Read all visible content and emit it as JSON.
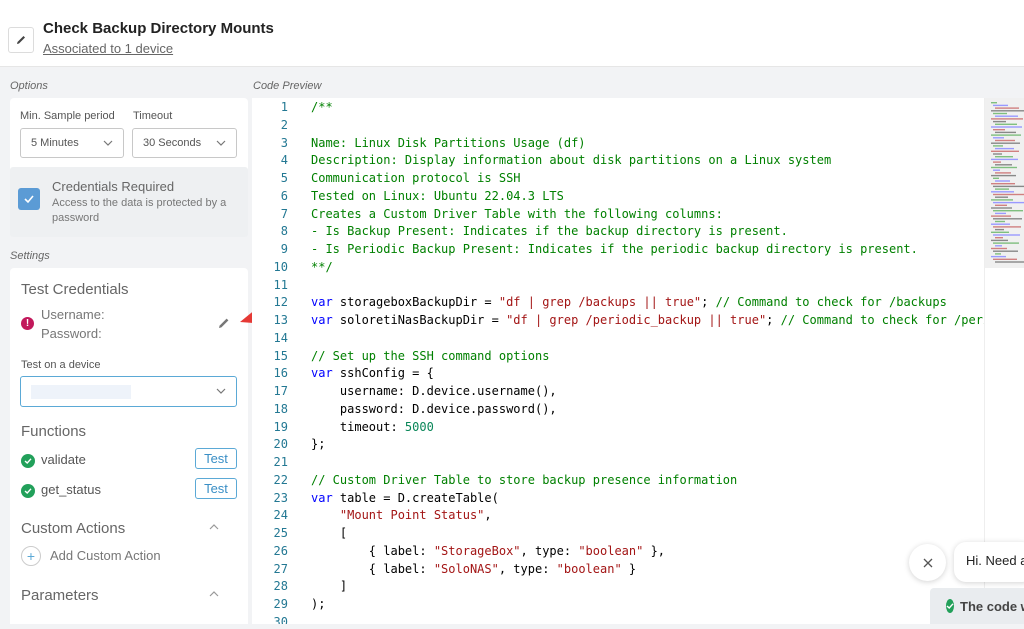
{
  "header": {
    "title": "Check Backup Directory Mounts",
    "associated": "Associated to 1 device"
  },
  "options": {
    "section_label": "Options",
    "min_sample_label": "Min. Sample period",
    "min_sample_value": "5 Minutes",
    "timeout_label": "Timeout",
    "timeout_value": "30 Seconds",
    "cred_title": "Credentials Required",
    "cred_desc": "Access to the data is protected by a password"
  },
  "settings": {
    "section_label": "Settings",
    "test_credentials": "Test Credentials",
    "username_label": "Username:",
    "password_label": "Password:",
    "test_device_label": "Test on a device",
    "functions_heading": "Functions",
    "functions": [
      {
        "name": "validate",
        "button": "Test"
      },
      {
        "name": "get_status",
        "button": "Test"
      }
    ],
    "custom_actions_heading": "Custom Actions",
    "add_custom_action": "Add Custom Action",
    "parameters_heading": "Parameters"
  },
  "code_preview": {
    "section_label": "Code Preview",
    "lines": [
      {
        "n": "1",
        "t": [
          {
            "c": "cm",
            "s": "/**"
          }
        ]
      },
      {
        "n": "2",
        "t": []
      },
      {
        "n": "3",
        "t": [
          {
            "c": "cm",
            "s": "Name: Linux Disk Partitions Usage (df)"
          }
        ]
      },
      {
        "n": "4",
        "t": [
          {
            "c": "cm",
            "s": "Description: Display information about disk partitions on a Linux system"
          }
        ]
      },
      {
        "n": "5",
        "t": [
          {
            "c": "cm",
            "s": "Communication protocol is SSH"
          }
        ]
      },
      {
        "n": "6",
        "t": [
          {
            "c": "cm",
            "s": "Tested on Linux: Ubuntu 22.04.3 LTS"
          }
        ]
      },
      {
        "n": "7",
        "t": [
          {
            "c": "cm",
            "s": "Creates a Custom Driver Table with the following columns:"
          }
        ]
      },
      {
        "n": "8",
        "t": [
          {
            "c": "cm",
            "s": "- Is Backup Present: Indicates if the backup directory is present."
          }
        ]
      },
      {
        "n": "9",
        "t": [
          {
            "c": "cm",
            "s": "- Is Periodic Backup Present: Indicates if the periodic backup directory is present."
          }
        ]
      },
      {
        "n": "10",
        "t": [
          {
            "c": "cm",
            "s": "**/"
          }
        ]
      },
      {
        "n": "11",
        "t": []
      },
      {
        "n": "12",
        "t": [
          {
            "c": "kw",
            "s": "var"
          },
          {
            "c": "",
            "s": " storageboxBackupDir = "
          },
          {
            "c": "st",
            "s": "\"df | grep /backups || true\""
          },
          {
            "c": "",
            "s": "; "
          },
          {
            "c": "cm",
            "s": "// Command to check for /backups"
          }
        ]
      },
      {
        "n": "13",
        "t": [
          {
            "c": "kw",
            "s": "var"
          },
          {
            "c": "",
            "s": " soloretiNasBackupDir = "
          },
          {
            "c": "st",
            "s": "\"df | grep /periodic_backup || true\""
          },
          {
            "c": "",
            "s": "; "
          },
          {
            "c": "cm",
            "s": "// Command to check for /periodic_backup"
          }
        ]
      },
      {
        "n": "14",
        "t": []
      },
      {
        "n": "15",
        "t": [
          {
            "c": "cm",
            "s": "// Set up the SSH command options"
          }
        ]
      },
      {
        "n": "16",
        "t": [
          {
            "c": "kw",
            "s": "var"
          },
          {
            "c": "",
            "s": " sshConfig = {"
          }
        ]
      },
      {
        "n": "17",
        "t": [
          {
            "c": "",
            "s": "    username: D.device.username(),"
          }
        ]
      },
      {
        "n": "18",
        "t": [
          {
            "c": "",
            "s": "    password: D.device.password(),"
          }
        ]
      },
      {
        "n": "19",
        "t": [
          {
            "c": "",
            "s": "    timeout: "
          },
          {
            "c": "nu",
            "s": "5000"
          }
        ]
      },
      {
        "n": "20",
        "t": [
          {
            "c": "",
            "s": "};"
          }
        ]
      },
      {
        "n": "21",
        "t": []
      },
      {
        "n": "22",
        "t": [
          {
            "c": "cm",
            "s": "// Custom Driver Table to store backup presence information"
          }
        ]
      },
      {
        "n": "23",
        "t": [
          {
            "c": "kw",
            "s": "var"
          },
          {
            "c": "",
            "s": " table = D.createTable("
          }
        ]
      },
      {
        "n": "24",
        "t": [
          {
            "c": "",
            "s": "    "
          },
          {
            "c": "st",
            "s": "\"Mount Point Status\""
          },
          {
            "c": "",
            "s": ","
          }
        ]
      },
      {
        "n": "25",
        "t": [
          {
            "c": "",
            "s": "    ["
          }
        ]
      },
      {
        "n": "26",
        "t": [
          {
            "c": "",
            "s": "        { label: "
          },
          {
            "c": "st",
            "s": "\"StorageBox\""
          },
          {
            "c": "",
            "s": ", type: "
          },
          {
            "c": "st",
            "s": "\"boolean\""
          },
          {
            "c": "",
            "s": " },"
          }
        ]
      },
      {
        "n": "27",
        "t": [
          {
            "c": "",
            "s": "        { label: "
          },
          {
            "c": "st",
            "s": "\"SoloNAS\""
          },
          {
            "c": "",
            "s": ", type: "
          },
          {
            "c": "st",
            "s": "\"boolean\""
          },
          {
            "c": "",
            "s": " }"
          }
        ]
      },
      {
        "n": "28",
        "t": [
          {
            "c": "",
            "s": "    ]"
          }
        ]
      },
      {
        "n": "29",
        "t": [
          {
            "c": "",
            "s": ");"
          }
        ]
      },
      {
        "n": "30",
        "t": []
      }
    ]
  },
  "chat": {
    "greeting": "Hi. Need any help?",
    "toast": "The code was generated"
  },
  "colors": {
    "accent": "#5b9bd5",
    "success": "#22a05a",
    "error": "#c2185b",
    "arrow": "#e53935"
  }
}
